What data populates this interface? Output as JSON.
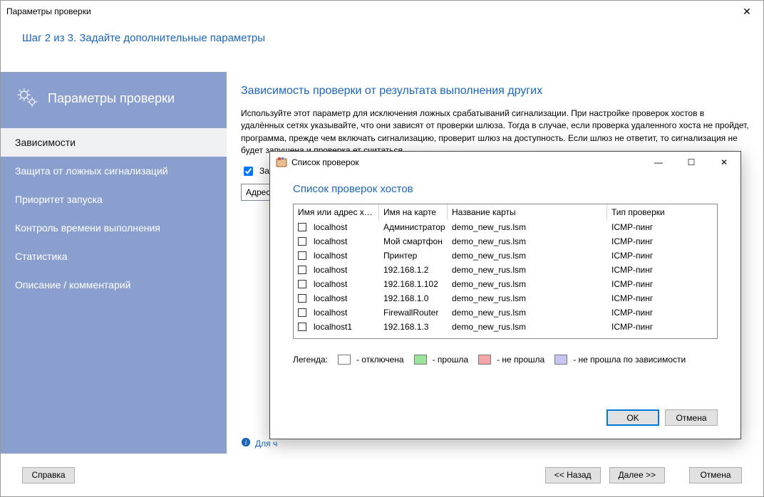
{
  "window": {
    "title": "Параметры проверки"
  },
  "step": "Шаг 2 из 3. Задайте дополнительные параметры",
  "sidebar": {
    "title": "Параметры проверки",
    "items": [
      {
        "label": "Зависимости",
        "selected": true
      },
      {
        "label": "Защита от ложных сигнализаций"
      },
      {
        "label": "Приоритет запуска"
      },
      {
        "label": "Контроль времени выполнения"
      },
      {
        "label": "Статистика"
      },
      {
        "label": "Описание / комментарий"
      }
    ]
  },
  "content": {
    "heading": "Зависимость проверки от результата выполнения других",
    "description": "Используйте этот параметр для исключения ложных срабатываний сигнализации. При настройке проверок хостов в удалённых сетях указывайте, что они зависят от проверки шлюза. Тогда в случае, если проверка удаленного хоста не пройдет, программа, прежде чем включать сигнализацию, проверит шлюз на доступность. Если шлюз не ответит, то сигнализация не будет запущена и проверка                                                                                                                                                                                                                                                         ет считаться",
    "depend_checkbox_label": "Зависи",
    "partial_col": "Адрес и",
    "info_link": "Для ч"
  },
  "dialog": {
    "title": "Список проверок",
    "heading": "Список проверок хостов",
    "headers": [
      "Имя или адрес хо...",
      "Имя на карте",
      "Название карты",
      "Тип проверки"
    ],
    "rows": [
      {
        "c0": "localhost",
        "c1": "Администратор",
        "c2": "demo_new_rus.lsm",
        "c3": "ICMP-пинг"
      },
      {
        "c0": "localhost",
        "c1": "Мой смартфон",
        "c2": "demo_new_rus.lsm",
        "c3": "ICMP-пинг"
      },
      {
        "c0": "localhost",
        "c1": "Принтер",
        "c2": "demo_new_rus.lsm",
        "c3": "ICMP-пинг"
      },
      {
        "c0": "localhost",
        "c1": "192.168.1.2",
        "c2": "demo_new_rus.lsm",
        "c3": "ICMP-пинг"
      },
      {
        "c0": "localhost",
        "c1": "192.168.1.102",
        "c2": "demo_new_rus.lsm",
        "c3": "ICMP-пинг"
      },
      {
        "c0": "localhost",
        "c1": "192.168.1.0",
        "c2": "demo_new_rus.lsm",
        "c3": "ICMP-пинг"
      },
      {
        "c0": "localhost",
        "c1": "FirewallRouter",
        "c2": "demo_new_rus.lsm",
        "c3": "ICMP-пинг"
      },
      {
        "c0": "localhost1",
        "c1": "192.168.1.3",
        "c2": "demo_new_rus.lsm",
        "c3": "ICMP-пинг"
      }
    ],
    "legend": {
      "title": "Легенда:",
      "items": [
        {
          "color": "#ffffff",
          "label": "- отключена"
        },
        {
          "color": "#9be49b",
          "label": "- прошла"
        },
        {
          "color": "#f4a7a7",
          "label": "- не прошла"
        },
        {
          "color": "#c6c4f2",
          "label": "- не прошла по зависимости"
        }
      ]
    },
    "buttons": {
      "ok": "OK",
      "cancel": "Отмена"
    }
  },
  "footer": {
    "help": "Справка",
    "back": "<< Назад",
    "next": "Далее >>",
    "cancel": "Отмена"
  }
}
